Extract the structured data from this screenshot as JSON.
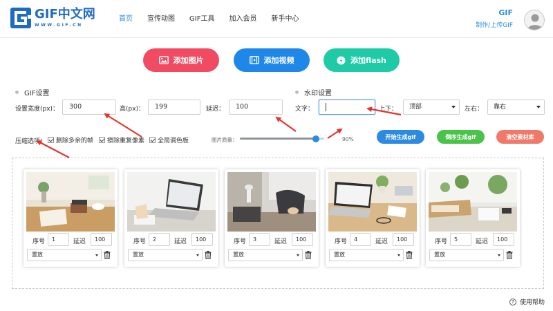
{
  "header": {
    "logo_title": "GIF中文网",
    "logo_sub": "WWW.GIF.CN",
    "nav": [
      "首页",
      "宣传动图",
      "GIF工具",
      "加入会员",
      "新手中心"
    ],
    "active_nav": "首页",
    "user_label": "GIF",
    "upload_link": "制作/上传GIF",
    "avatar_icon": "avatar-icon"
  },
  "add_buttons": [
    {
      "label": "添加图片",
      "icon": "image-icon",
      "color": "#f04b63"
    },
    {
      "label": "添加视频",
      "icon": "film-icon",
      "color": "#1e87e8"
    },
    {
      "label": "添加flash",
      "icon": "flash-icon",
      "color": "#1fcba7"
    }
  ],
  "gif_settings": {
    "title": "GIF设置",
    "width_label": "设置宽度(px)：",
    "width_value": "300",
    "height_label": "高(px)：",
    "height_value": "199",
    "delay_label": "延迟：",
    "delay_value": "100"
  },
  "watermark": {
    "title": "水印设置",
    "text_label": "文字：",
    "text_value": "",
    "vertical_label": "上下：",
    "vertical_value": "顶部",
    "horizontal_label": "左右：",
    "horizontal_value": "靠右"
  },
  "compress": {
    "label": "压缩选项：",
    "options": [
      "删除多余的帧",
      "擦除重复像素",
      "全局调色板"
    ],
    "quality_label": "图片质量：",
    "quality_value": "90%",
    "quality_fraction": 0.9
  },
  "actions": [
    {
      "label": "开始生成gif",
      "color": "#2c8be0"
    },
    {
      "label": "倒序生成gif",
      "color": "#4bc34b"
    },
    {
      "label": "清空素材库",
      "color": "#f07a6a"
    }
  ],
  "frame_labels": {
    "seq_label": "序号",
    "delay_label": "延迟",
    "position_default": "置放",
    "trash_icon": "trash-icon"
  },
  "frames": [
    {
      "seq": "1",
      "delay": "100",
      "position": "置放"
    },
    {
      "seq": "2",
      "delay": "100",
      "position": "置放"
    },
    {
      "seq": "3",
      "delay": "100",
      "position": "置放"
    },
    {
      "seq": "4",
      "delay": "100",
      "position": "置放"
    },
    {
      "seq": "5",
      "delay": "100",
      "position": "置放"
    }
  ],
  "help": {
    "label": "使用帮助",
    "icon": "help-icon"
  }
}
